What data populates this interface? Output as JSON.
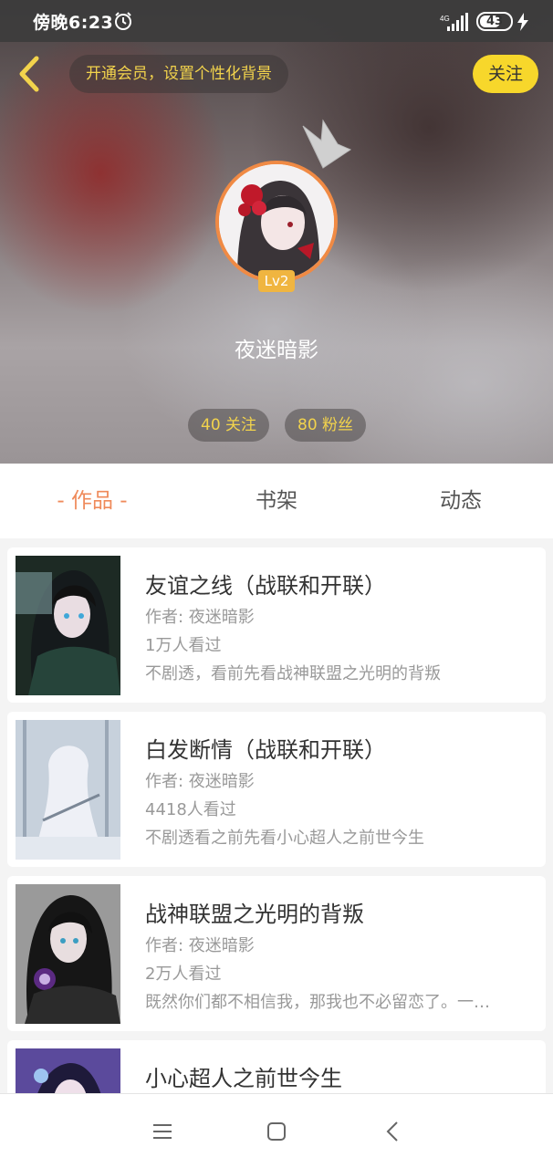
{
  "status_bar": {
    "time": "傍晚6:23",
    "network": "4G",
    "battery": "43"
  },
  "header": {
    "vip_banner": "开通会员，设置个性化背景",
    "follow_label": "关注",
    "level": "Lv2",
    "username": "夜迷暗影",
    "following": "40 关注",
    "followers": "80 粉丝"
  },
  "tabs": [
    {
      "label": "- 作品 -",
      "active": true
    },
    {
      "label": "书架",
      "active": false
    },
    {
      "label": "动态",
      "active": false
    }
  ],
  "books": [
    {
      "title": "友谊之线（战联和开联）",
      "author": "作者: 夜迷暗影",
      "views": "1万人看过",
      "desc": "不剧透，看前先看战神联盟之光明的背叛"
    },
    {
      "title": "白发断情（战联和开联）",
      "author": "作者: 夜迷暗影",
      "views": "4418人看过",
      "desc": "不剧透看之前先看小心超人之前世今生"
    },
    {
      "title": "战神联盟之光明的背叛",
      "author": "作者: 夜迷暗影",
      "views": "2万人看过",
      "desc": "既然你们都不相信我，那我也不必留恋了。一…"
    },
    {
      "title": "小心超人之前世今生",
      "author": "",
      "views": "",
      "desc": ""
    }
  ],
  "icons": {
    "back": "chevron-left-icon",
    "alarm": "alarm-clock-icon",
    "crown": "crown-icon",
    "menu": "menu-icon",
    "home": "square-home-icon",
    "nav_back": "triangle-back-icon"
  },
  "colors": {
    "accent": "#ef8a5a",
    "follow_button": "#f7d72b",
    "highlight_text": "#f2d34c",
    "avatar_ring": "#f08a44",
    "level_badge": "#f0b540"
  }
}
